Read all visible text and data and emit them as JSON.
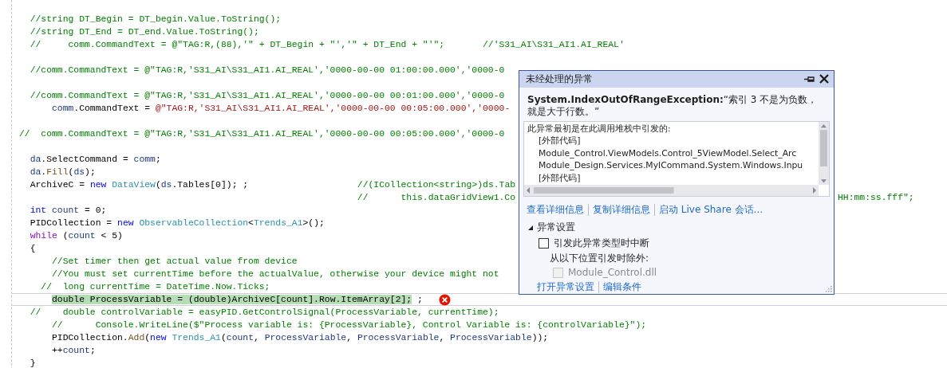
{
  "editor": {
    "lines": [
      {
        "current": false,
        "error": false,
        "tokens": [
          {
            "text": "  //string DT_Begin = DT_begin.Value.ToString();",
            "kind": "comment"
          }
        ]
      },
      {
        "current": false,
        "error": false,
        "tokens": [
          {
            "text": "  //string DT_End = DT_end.Value.ToString();",
            "kind": "comment"
          }
        ]
      },
      {
        "current": false,
        "error": false,
        "tokens": [
          {
            "text": "  //     comm.CommandText = @\"TAG:R,(88),'\" + DT_Begin + \"','\" + DT_End + \"'\";       //'S31_AI\\S31_AI1.AI_REAL'",
            "kind": "comment"
          }
        ]
      },
      {
        "current": false,
        "error": false
      },
      {
        "current": false,
        "error": false,
        "tokens": [
          {
            "text": "  //comm.CommandText = @\"TAG:R,'S31_AI\\S31_AI1.AI_REAL','0000-00-00 01:00:00.000','0000-0",
            "kind": "comment"
          }
        ]
      },
      {
        "current": false,
        "error": false
      },
      {
        "current": false,
        "error": false,
        "tokens": [
          {
            "text": "  //comm.CommandText = @\"TAG:R,'S31_AI\\S31_AI1.AI_REAL','0000-00-00 00:01:00.000','0000-0",
            "kind": "comment"
          }
        ]
      },
      {
        "current": false,
        "error": false,
        "tokens": [
          {
            "text": "      comm",
            "kind": "ident"
          },
          {
            "text": ".CommandText = ",
            "kind": "plain"
          },
          {
            "text": "@\"TAG:R,'S31_AI\\S31_AI1.AI_REAL','0000-00-00 00:05:00.000','0000-",
            "kind": "string"
          }
        ]
      },
      {
        "current": false,
        "error": false
      },
      {
        "current": false,
        "error": false,
        "tokens": [
          {
            "text": "//  comm.CommandText = @\"TAG:R,'S31_AI\\S31_AI1.AI_REAL','0000-00-00 00:05:00.000','0000-0",
            "kind": "comment"
          }
        ]
      },
      {
        "current": false,
        "error": false
      },
      {
        "current": false,
        "error": false,
        "tokens": [
          {
            "text": "  da",
            "kind": "ident"
          },
          {
            "text": ".SelectCommand = ",
            "kind": "plain"
          },
          {
            "text": "comm",
            "kind": "ident"
          },
          {
            "text": ";",
            "kind": "plain"
          }
        ]
      },
      {
        "current": false,
        "error": false,
        "tokens": [
          {
            "text": "  da",
            "kind": "ident"
          },
          {
            "text": ".",
            "kind": "plain"
          },
          {
            "text": "Fill",
            "kind": "method"
          },
          {
            "text": "(",
            "kind": "plain"
          },
          {
            "text": "ds",
            "kind": "ident"
          },
          {
            "text": ");",
            "kind": "plain"
          }
        ]
      },
      {
        "current": false,
        "error": false,
        "tokens": [
          {
            "text": "  ArchiveC = ",
            "kind": "plain"
          },
          {
            "text": "new",
            "kind": "keyword"
          },
          {
            "text": " DataView",
            "kind": "type"
          },
          {
            "text": "(",
            "kind": "plain"
          },
          {
            "text": "ds",
            "kind": "ident"
          },
          {
            "text": ".Tables[0]); ;                    ",
            "kind": "plain"
          },
          {
            "text": "//(ICollection<string>)ds.Tab",
            "kind": "comment"
          }
        ]
      },
      {
        "current": false,
        "error": false,
        "tokens": [
          {
            "text": "                                                              //      this.dataGridView1.Co",
            "kind": "comment"
          }
        ],
        "tail": [
          {
            "text": "HH:mm:ss.fff\";",
            "kind": "comment"
          }
        ]
      },
      {
        "current": false,
        "error": false,
        "tokens": [
          {
            "text": "  int",
            "kind": "keyword"
          },
          {
            "text": " count",
            "kind": "ident"
          },
          {
            "text": " = 0;",
            "kind": "plain"
          }
        ]
      },
      {
        "current": false,
        "error": false,
        "tokens": [
          {
            "text": "  PIDCollection = ",
            "kind": "plain"
          },
          {
            "text": "new",
            "kind": "keyword"
          },
          {
            "text": " ObservableCollection",
            "kind": "type"
          },
          {
            "text": "<",
            "kind": "plain"
          },
          {
            "text": "Trends_A1",
            "kind": "type"
          },
          {
            "text": ">();",
            "kind": "plain"
          }
        ]
      },
      {
        "current": false,
        "error": false,
        "tokens": [
          {
            "text": "  while",
            "kind": "control"
          },
          {
            "text": " (",
            "kind": "plain"
          },
          {
            "text": "count",
            "kind": "ident"
          },
          {
            "text": " < 5)",
            "kind": "plain"
          }
        ]
      },
      {
        "current": false,
        "error": false,
        "tokens": [
          {
            "text": "  {",
            "kind": "plain"
          }
        ]
      },
      {
        "current": false,
        "error": false,
        "tokens": [
          {
            "text": "      //Set timer then get actual value from device",
            "kind": "comment"
          }
        ]
      },
      {
        "current": false,
        "error": false,
        "tokens": [
          {
            "text": "      //You must set currentTime before the actualValue, otherwise your device might not",
            "kind": "comment"
          }
        ]
      },
      {
        "current": false,
        "error": false,
        "tokens": [
          {
            "text": "    //  long currentTime = DateTime.Now.Ticks;",
            "kind": "comment"
          }
        ]
      },
      {
        "current": true,
        "error": true,
        "tokens": [
          {
            "text": "      double ProcessVariable = (double)ArchiveC[count].Row.ItemArray[2];",
            "kind": "statement"
          },
          {
            "text": " ;",
            "kind": "plain"
          }
        ]
      },
      {
        "current": false,
        "error": false,
        "tokens": [
          {
            "text": "  //    double controlVariable = easyPID.GetControlSignal(ProcessVariable, currentTime);",
            "kind": "comment"
          }
        ]
      },
      {
        "current": false,
        "error": false,
        "tokens": [
          {
            "text": "      //      Console.WriteLine($\"Process variable is: {ProcessVariable}, Control Variable is: {controlVariable}\");",
            "kind": "comment"
          }
        ]
      },
      {
        "current": false,
        "error": false,
        "tokens": [
          {
            "text": "      PIDCollection.",
            "kind": "plain"
          },
          {
            "text": "Add",
            "kind": "method"
          },
          {
            "text": "(",
            "kind": "plain"
          },
          {
            "text": "new",
            "kind": "keyword"
          },
          {
            "text": " Trends_A1",
            "kind": "type"
          },
          {
            "text": "(",
            "kind": "plain"
          },
          {
            "text": "count",
            "kind": "ident"
          },
          {
            "text": ", ",
            "kind": "plain"
          },
          {
            "text": "ProcessVariable",
            "kind": "ident"
          },
          {
            "text": ", ",
            "kind": "plain"
          },
          {
            "text": "ProcessVariable",
            "kind": "ident"
          },
          {
            "text": ", ",
            "kind": "plain"
          },
          {
            "text": "ProcessVariable",
            "kind": "ident"
          },
          {
            "text": "));",
            "kind": "plain"
          }
        ]
      },
      {
        "current": false,
        "error": false,
        "tokens": [
          {
            "text": "      ++",
            "kind": "plain"
          },
          {
            "text": "count",
            "kind": "ident"
          },
          {
            "text": ";",
            "kind": "plain"
          }
        ]
      },
      {
        "current": false,
        "error": false,
        "tokens": [
          {
            "text": "  }",
            "kind": "plain"
          }
        ]
      }
    ]
  },
  "exception_popup": {
    "title": "未经处理的异常",
    "message": "**System.IndexOutOfRangeException:**“索引 3 不是为负数，就是大于行数。”",
    "stack": {
      "heading": "此异常最初是在此调用堆栈中引发的:",
      "frames": [
        "[外部代码]",
        "Module_Control.ViewModels.Control_5ViewModel.Select_Arc",
        "Module_Design.Services.MyICommand.System.Windows.Inpu",
        "[外部代码]"
      ]
    },
    "links": [
      "查看详细信息",
      "复制详细信息",
      "启动 Live Share 会话..."
    ],
    "settings": {
      "title": "异常设置",
      "expanded": true,
      "options": [
        {
          "label": "引发此异常类型时中断",
          "checked": false,
          "disabled": false
        }
      ],
      "exceptions_label": "从以下位置引发时除外:",
      "exceptions": [
        {
          "label": "Module_Control.dll",
          "checked": false,
          "disabled": true
        }
      ],
      "links": [
        "打开异常设置",
        "编辑条件"
      ]
    }
  }
}
